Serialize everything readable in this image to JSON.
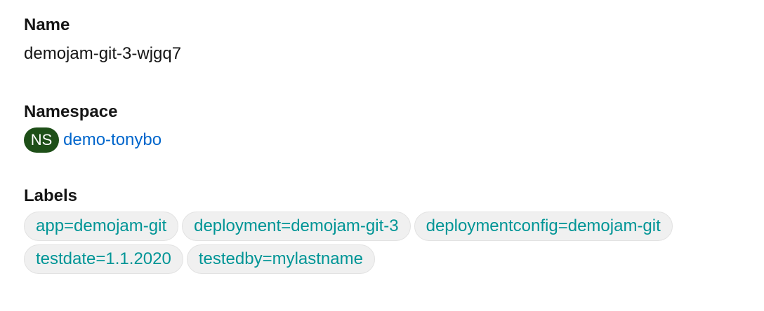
{
  "name": {
    "label": "Name",
    "value": "demojam-git-3-wjgq7"
  },
  "namespace": {
    "label": "Namespace",
    "badge": "NS",
    "value": "demo-tonybo",
    "badge_color": "#1e4f18",
    "link_color": "#0066cc"
  },
  "labels": {
    "label": "Labels",
    "chip_text_color": "#009596",
    "items": [
      "app=demojam-git",
      "deployment=demojam-git-3",
      "deploymentconfig=demojam-git",
      "testdate=1.1.2020",
      "testedby=mylastname"
    ]
  }
}
